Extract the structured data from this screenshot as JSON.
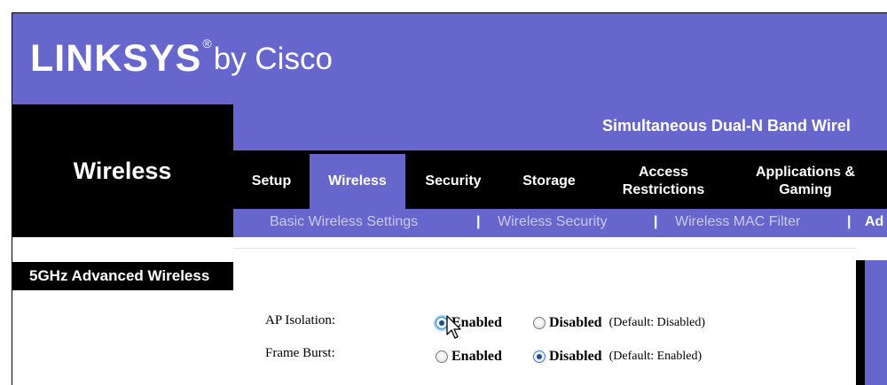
{
  "header": {
    "brand": "LINKSYS",
    "registered": "®",
    "by_cisco": "by Cisco"
  },
  "section": {
    "title": "Wireless"
  },
  "product": {
    "name": "Simultaneous Dual-N Band Wirel"
  },
  "tabs": [
    {
      "label": "Setup",
      "active": false
    },
    {
      "label": "Wireless",
      "active": true
    },
    {
      "label": "Security",
      "active": false
    },
    {
      "label": "Storage",
      "active": false
    },
    {
      "label": "Access Restrictions",
      "active": false
    },
    {
      "label": "Applications & Gaming",
      "active": false
    }
  ],
  "subnav": {
    "items": [
      "Basic Wireless Settings",
      "Wireless Security",
      "Wireless MAC Filter",
      "Ad"
    ],
    "separator": "|"
  },
  "sidebar": {
    "title": "5GHz Advanced Wireless"
  },
  "settings": [
    {
      "label": "AP Isolation:",
      "enabled_label": "Enabled",
      "disabled_label": "Disabled",
      "selected": "Enabled",
      "default_note": "(Default: Disabled)"
    },
    {
      "label": "Frame Burst:",
      "enabled_label": "Enabled",
      "disabled_label": "Disabled",
      "selected": "Disabled",
      "default_note": "(Default: Enabled)"
    }
  ],
  "colors": {
    "brand_purple": "#6666cc",
    "black": "#000000",
    "subnav_text": "#c9c9f0"
  }
}
